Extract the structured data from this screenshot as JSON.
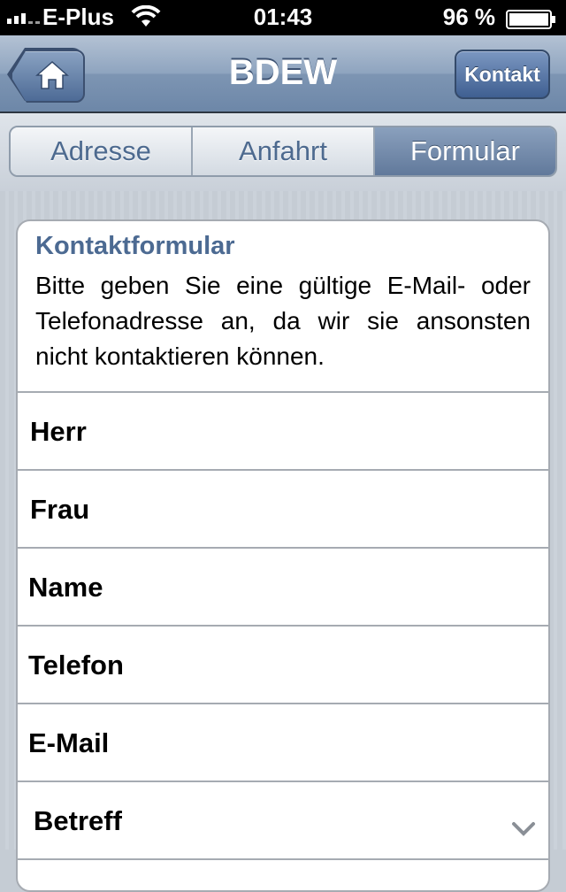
{
  "status": {
    "carrier": "E-Plus",
    "time": "01:43",
    "battery": "96 %"
  },
  "nav": {
    "title": "BDEW",
    "contact_label": "Kontakt"
  },
  "tabs": [
    {
      "label": "Adresse",
      "active": false
    },
    {
      "label": "Anfahrt",
      "active": false
    },
    {
      "label": "Formular",
      "active": true
    }
  ],
  "form": {
    "title": "Kontaktformular",
    "intro": "Bitte geben Sie eine gültige E-Mail- oder Telefonadresse an, da wir sie ansonsten nicht kontaktieren können.",
    "fields": {
      "herr": "Herr",
      "frau": "Frau",
      "name": "Name",
      "telefon": "Telefon",
      "email": "E-Mail",
      "betreff": "Betreff"
    }
  },
  "colors": {
    "accent": "#4c6a92",
    "nav": "#7d95b3"
  }
}
